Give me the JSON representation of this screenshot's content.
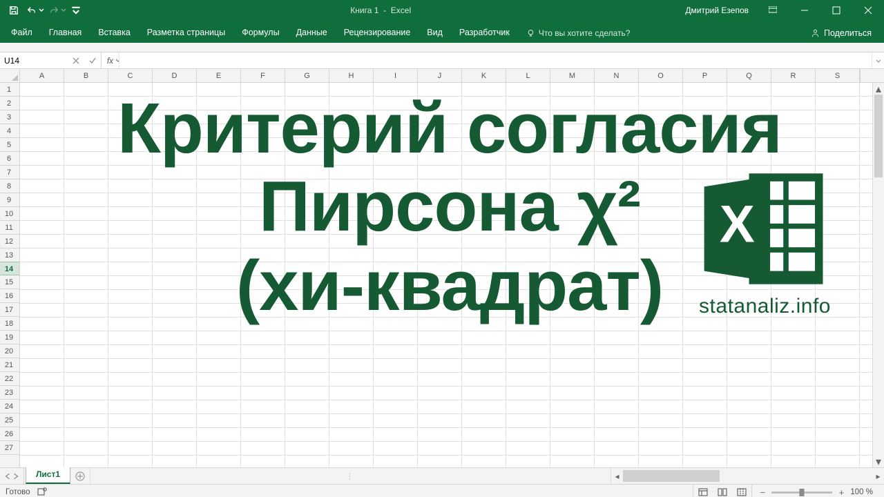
{
  "title": {
    "doc": "Книга 1",
    "app": "Excel"
  },
  "user": "Дмитрий Езепов",
  "ribbon": {
    "tabs": [
      "Файл",
      "Главная",
      "Вставка",
      "Разметка страницы",
      "Формулы",
      "Данные",
      "Рецензирование",
      "Вид",
      "Разработчик"
    ],
    "tellme": "Что вы хотите сделать?",
    "share": "Поделиться"
  },
  "namebox": "U14",
  "fx": "fx",
  "formula": "",
  "columns": [
    "A",
    "B",
    "C",
    "D",
    "E",
    "F",
    "G",
    "H",
    "I",
    "J",
    "K",
    "L",
    "M",
    "N",
    "O",
    "P",
    "Q",
    "R",
    "S"
  ],
  "rows": [
    "1",
    "2",
    "3",
    "4",
    "5",
    "6",
    "7",
    "8",
    "9",
    "10",
    "11",
    "12",
    "13",
    "14",
    "15",
    "16",
    "17",
    "18",
    "19",
    "20",
    "21",
    "22",
    "23",
    "24",
    "25",
    "26",
    "27"
  ],
  "active_row": "14",
  "overlay": {
    "line1": "Критерий согласия",
    "line2": "Пирсона χ²",
    "line3": "(хи-квадрат)",
    "brand": "statanaliz.info"
  },
  "sheet": {
    "name": "Лист1"
  },
  "status": {
    "ready": "Готово",
    "zoom": "100 %"
  }
}
